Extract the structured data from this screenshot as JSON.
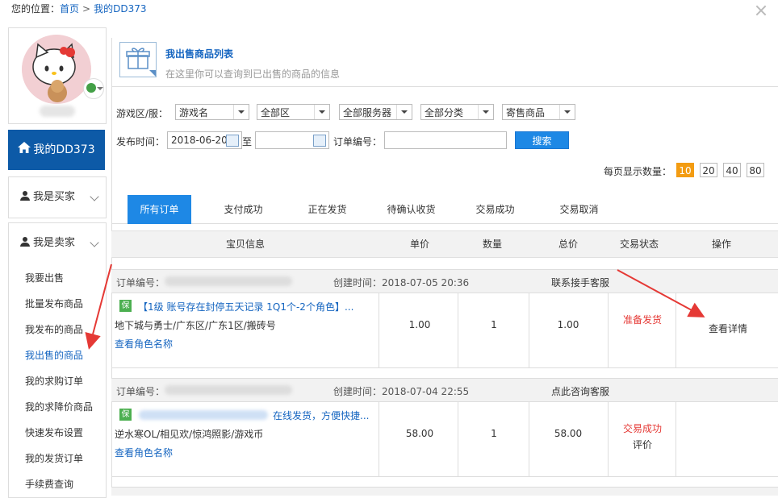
{
  "breadcrumb": {
    "prefix": "您的位置：",
    "home": "首页",
    "sep": ">",
    "current": "我的DD373"
  },
  "sidebar": {
    "my_dd": "我的DD373",
    "buyer": "我是买家",
    "seller": "我是卖家",
    "items": [
      {
        "label": "我要出售"
      },
      {
        "label": "批量发布商品"
      },
      {
        "label": "我发布的商品"
      },
      {
        "label": "我出售的商品"
      },
      {
        "label": "我的求购订单"
      },
      {
        "label": "我的求降价商品"
      },
      {
        "label": "快速发布设置"
      },
      {
        "label": "我的发货订单"
      },
      {
        "label": "手续费查询"
      }
    ]
  },
  "header": {
    "title": "我出售商品列表",
    "subtitle": "在这里你可以查询到已出售的商品的信息"
  },
  "filters": {
    "game_label": "游戏区/服：",
    "game": "游戏名",
    "area": "全部区",
    "server": "全部服务器",
    "category": "全部分类",
    "mode": "寄售商品",
    "time_label": "发布时间：",
    "date_from": "2018-06-20",
    "to": "至",
    "date_to": "",
    "order_label": "订单编号：",
    "order_no": "",
    "search": "搜索"
  },
  "per_page": {
    "label": "每页显示数量：",
    "options": [
      "10",
      "20",
      "40",
      "80"
    ],
    "selected": "10"
  },
  "tabs": [
    "所有订单",
    "支付成功",
    "正在发货",
    "待确认收货",
    "交易成功",
    "交易取消"
  ],
  "table_headers": [
    "宝贝信息",
    "单价",
    "数量",
    "总价",
    "交易状态",
    "操作"
  ],
  "orders": [
    {
      "order_label": "订单编号：",
      "created": "创建时间：2018-07-05 20:36",
      "contact": "联系接手客服",
      "badge": "保",
      "title": "【1级 账号存在封停五天记录 1Q1个-2个角色】...",
      "game": "地下城与勇士/广东区/广东1区/搬砖号",
      "view_role": "查看角色名称",
      "price": "1.00",
      "qty": "1",
      "total": "1.00",
      "status": "准备发货",
      "action": "查看详情"
    },
    {
      "order_label": "订单编号：",
      "created": "创建时间：2018-07-04 22:55",
      "contact": "点此咨询客服",
      "badge": "保",
      "title": "在线发货，方便快捷...",
      "game": "逆水寒OL/相见欢/惊鸿照影/游戏币",
      "view_role": "查看角色名称",
      "price": "58.00",
      "qty": "1",
      "total": "58.00",
      "status": "交易成功",
      "action": "评价"
    }
  ],
  "colors": {
    "accent": "#1e88e5",
    "nav": "#0d5aa7",
    "red": "#e53935",
    "badge": "#4caf50",
    "orange": "#f39c12"
  }
}
